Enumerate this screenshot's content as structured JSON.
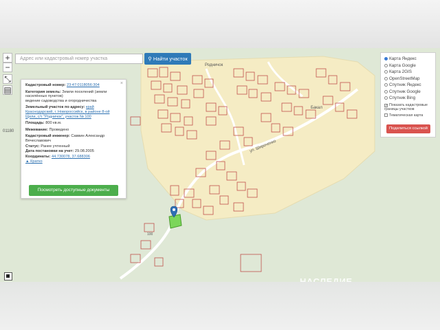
{
  "search": {
    "placeholder": "Адрес или кадастровый номер участка",
    "button_label": "Найти участок"
  },
  "map_controls": {
    "zoom_in": "+",
    "zoom_out": "−"
  },
  "info_panel": {
    "cadastral_number_label": "Кадастровый номер:",
    "cadastral_number": "23:47:0118056:304",
    "land_category_label": "Категория земель:",
    "land_category": "Земли поселений (земли населённых пунктов)",
    "land_use": "ведение садоводства и огородничества",
    "address_label": "Земельный участок по адресу:",
    "address": "край Краснодарский, г. Новороссийск, в районе 8-ой Щели, с/т \"Родничок\", участок № 100",
    "area_label": "Площадь:",
    "area": "800 кв.м.",
    "survey_label": "Межевание:",
    "survey": "Проведено",
    "engineer_label": "Кадастровый инженер:",
    "engineer": "Саввин Александр Вячеславович",
    "status_label": "Статус:",
    "status": "Ранее учтенный",
    "registered_label": "Дата постановки на учет:",
    "registered": "29.08.2005",
    "coords_label": "Координаты:",
    "coords": "44.730078, 37.688306",
    "collapse_link": "Кратко",
    "docs_button": "Посмотреть доступные документы",
    "close": "×"
  },
  "layers_panel": {
    "options": [
      "Карта Яндекс",
      "Карта Google",
      "Карта 2GIS",
      "OpenStreetMap",
      "Спутник Яндекс",
      "Спутник Google",
      "Спутник Bing"
    ],
    "selected": "Карта Яндекс",
    "show_borders": "Показать кадастровые границы участков",
    "thematic_map": "Тематическая карта",
    "share_button": "Поделиться ссылкой"
  },
  "map_labels": {
    "rodnichok": "Родничок",
    "bakal": "Бакал",
    "shirochenko": "ул. Широченко",
    "left_code": "01180",
    "marker_plot": "100",
    "watermark": "НАСЛЕДИЕ"
  },
  "colors": {
    "accent_blue": "#2f7ab8",
    "docs_green": "#4cae4c",
    "share_red": "#d9534f",
    "selected_plot": "#7cd65a"
  }
}
